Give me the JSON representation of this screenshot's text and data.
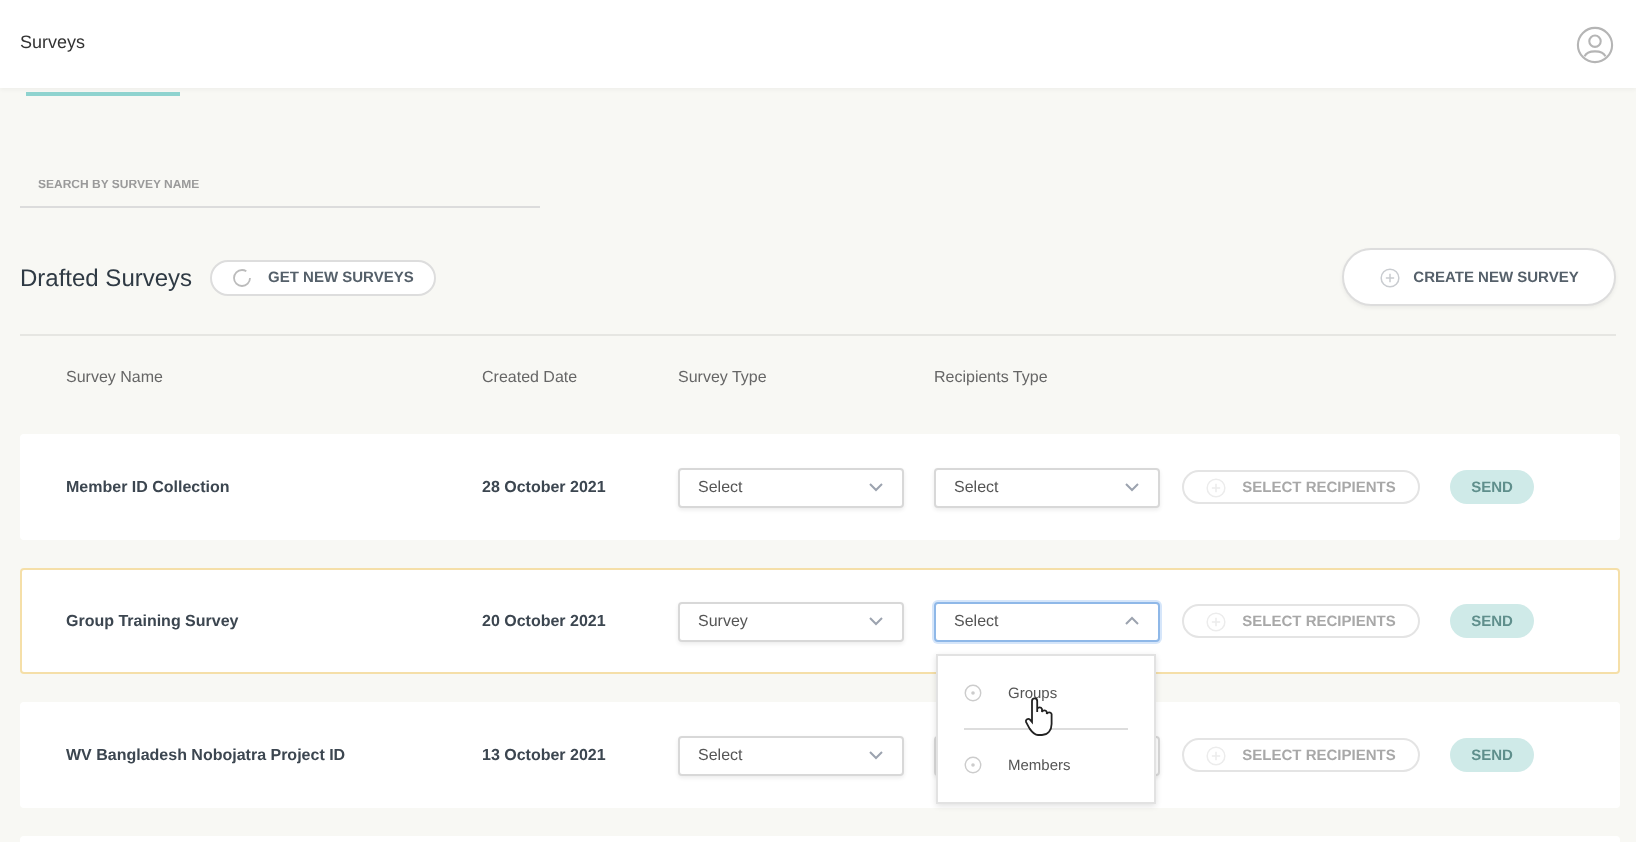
{
  "header": {
    "title": "Surveys"
  },
  "search": {
    "placeholder": "SEARCH BY SURVEY NAME"
  },
  "section": {
    "title": "Drafted Surveys",
    "refresh_button": "GET NEW SURVEYS",
    "create_button": "CREATE NEW SURVEY"
  },
  "table": {
    "columns": [
      "Survey Name",
      "Created Date",
      "Survey Type",
      "Recipients Type"
    ],
    "rows": [
      {
        "name": "Member ID Collection",
        "date": "28 October 2021",
        "survey_type": "Select",
        "recipients_type": "Select",
        "recipients_open": false,
        "selected": false,
        "select_recipients": "SELECT RECIPIENTS",
        "send": "SEND"
      },
      {
        "name": "Group Training Survey",
        "date": "20 October 2021",
        "survey_type": "Survey",
        "recipients_type": "Select",
        "recipients_open": true,
        "selected": true,
        "select_recipients": "SELECT RECIPIENTS",
        "send": "SEND"
      },
      {
        "name": "WV Bangladesh Nobojatra Project ID",
        "date": "13 October 2021",
        "survey_type": "Select",
        "recipients_open": false,
        "selected": false,
        "select_recipients": "SELECT RECIPIENTS",
        "send": "SEND"
      }
    ]
  },
  "dropdown": {
    "options": [
      "Groups",
      "Members"
    ]
  }
}
